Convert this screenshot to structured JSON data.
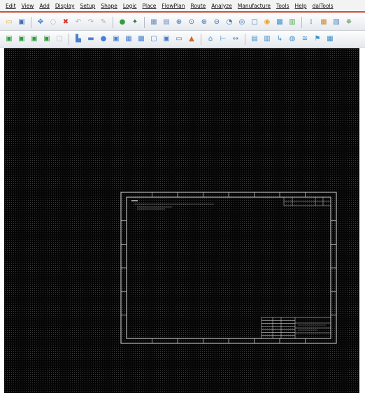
{
  "menu": {
    "items": [
      "Edit",
      "View",
      "Add",
      "Display",
      "Setup",
      "Shape",
      "Logic",
      "Place",
      "FlowPlan",
      "Route",
      "Analyze",
      "Manufacture",
      "Tools",
      "Help",
      "dalTools"
    ]
  },
  "toolbars": {
    "row1": [
      {
        "name": "open-icon",
        "glyph": "▭",
        "color": "#e6b43c"
      },
      {
        "name": "save-icon",
        "glyph": "▣",
        "color": "#3d6fb8"
      },
      {
        "sep": true
      },
      {
        "name": "move-icon",
        "glyph": "✥",
        "color": "#3a7bd5"
      },
      {
        "name": "copy-icon",
        "glyph": "◌",
        "color": "#888888"
      },
      {
        "name": "delete-icon",
        "glyph": "✖",
        "color": "#d93025"
      },
      {
        "name": "undo-icon",
        "glyph": "↶",
        "color": "#b0b0b0"
      },
      {
        "name": "redo-icon",
        "glyph": "↷",
        "color": "#b0b0b0"
      },
      {
        "name": "edit-icon",
        "glyph": "✎",
        "color": "#b0b0b0"
      },
      {
        "sep": true
      },
      {
        "name": "highlight-icon",
        "glyph": "●",
        "color": "#2e9e3e"
      },
      {
        "name": "pin-icon",
        "glyph": "✦",
        "color": "#2a7a3a"
      },
      {
        "sep": true
      },
      {
        "name": "grid-toggle-icon",
        "glyph": "▦",
        "color": "#6a8fbf"
      },
      {
        "name": "grid-layers-icon",
        "glyph": "▤",
        "color": "#6a8fbf"
      },
      {
        "name": "zoom-in-icon",
        "glyph": "⊕",
        "color": "#3a6fb0"
      },
      {
        "name": "zoom-fit-icon",
        "glyph": "⊙",
        "color": "#3a6fb0"
      },
      {
        "name": "zoom-world-icon",
        "glyph": "⊕",
        "color": "#3a6fb0"
      },
      {
        "name": "zoom-out-icon",
        "glyph": "⊖",
        "color": "#3a6fb0"
      },
      {
        "name": "zoom-previous-icon",
        "glyph": "◔",
        "color": "#3a6fb0"
      },
      {
        "name": "zoom-center-icon",
        "glyph": "◎",
        "color": "#3a6fb0"
      },
      {
        "name": "zoom-selection-icon",
        "glyph": "▢",
        "color": "#3a6fb0"
      },
      {
        "name": "refresh-icon",
        "glyph": "◉",
        "color": "#f0a020"
      },
      {
        "name": "3d-view-icon",
        "glyph": "▩",
        "color": "#3a8fcf"
      },
      {
        "name": "color-view-icon",
        "glyph": "▥",
        "color": "#4aa84a"
      },
      {
        "sep": true
      },
      {
        "name": "vias-icon",
        "glyph": "⁞",
        "color": "#3a6fb0"
      },
      {
        "name": "layers-icon",
        "glyph": "▦",
        "color": "#d08a2a"
      },
      {
        "name": "properties-icon",
        "glyph": "▧",
        "color": "#4a7fbf"
      },
      {
        "name": "settings-icon",
        "glyph": "✵",
        "color": "#4a8a4a"
      }
    ],
    "row2": [
      {
        "name": "schematic-green-icon",
        "glyph": "▣",
        "color": "#2e9e3e"
      },
      {
        "name": "board-green-icon",
        "glyph": "▣",
        "color": "#2e9e3e"
      },
      {
        "name": "layout-green-icon",
        "glyph": "▣",
        "color": "#2e9e3e"
      },
      {
        "name": "package-green-icon",
        "glyph": "▣",
        "color": "#2e9e3e"
      },
      {
        "name": "disabled-tool-icon",
        "glyph": "▢",
        "color": "#b8b8b8"
      },
      {
        "sep": true
      },
      {
        "name": "add-line-icon",
        "glyph": "▙",
        "color": "#4a7fd0"
      },
      {
        "name": "add-rect-icon",
        "glyph": "▬",
        "color": "#4a7fd0"
      },
      {
        "name": "add-circle-icon",
        "glyph": "●",
        "color": "#4a7fd0"
      },
      {
        "name": "add-frame-icon",
        "glyph": "▣",
        "color": "#4a7fd0"
      },
      {
        "name": "add-shape-icon",
        "glyph": "▦",
        "color": "#4a7fd0"
      },
      {
        "name": "add-polygon-icon",
        "glyph": "▩",
        "color": "#4a7fd0"
      },
      {
        "name": "add-void-icon",
        "glyph": "▢",
        "color": "#4a7fd0"
      },
      {
        "name": "add-outline-icon",
        "glyph": "▣",
        "color": "#4a7fd0"
      },
      {
        "name": "add-text-icon",
        "glyph": "▭",
        "color": "#4a7fd0"
      },
      {
        "name": "stack-icon",
        "glyph": "▲",
        "color": "#d06a2a"
      },
      {
        "sep": true
      },
      {
        "name": "home-icon",
        "glyph": "⌂",
        "color": "#3a8fcf"
      },
      {
        "name": "dimension-icon",
        "glyph": "⊢",
        "color": "#3a8fcf"
      },
      {
        "name": "measure-icon",
        "glyph": "↔",
        "color": "#3a8fcf"
      },
      {
        "sep": true
      },
      {
        "name": "bundle-icon",
        "glyph": "▤",
        "color": "#3a8fcf"
      },
      {
        "name": "cluster-icon",
        "glyph": "▥",
        "color": "#3a8fcf"
      },
      {
        "name": "flow-icon",
        "glyph": "↳",
        "color": "#3a8fcf"
      },
      {
        "name": "group-icon",
        "glyph": "◍",
        "color": "#3a8fcf"
      },
      {
        "name": "route-icon",
        "glyph": "≋",
        "color": "#3a8fcf"
      },
      {
        "name": "flag-icon",
        "glyph": "⚑",
        "color": "#3a8fcf"
      },
      {
        "name": "report-icon",
        "glyph": "▦",
        "color": "#3a8fcf"
      }
    ]
  },
  "colors": {
    "canvas_bg": "#050505",
    "grid_dot": "#3a3a3a",
    "outline": "#d8d8d8",
    "menu_accent": "#d84a3a"
  },
  "title_block": {
    "rows": 7,
    "columns": 4
  }
}
